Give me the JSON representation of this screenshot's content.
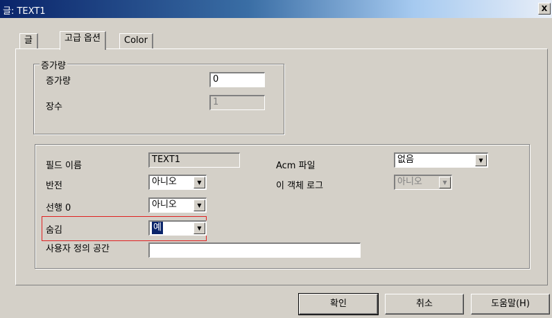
{
  "window": {
    "title": "글: TEXT1",
    "close_glyph": "X"
  },
  "tabs": [
    {
      "label": "글"
    },
    {
      "label": "고급 옵션"
    },
    {
      "label": "Color"
    }
  ],
  "increment_group": {
    "legend": "증가량",
    "increment_label": "증가량",
    "increment_value": "0",
    "count_label": "장수",
    "count_value": "1"
  },
  "field_group": {
    "field_name_label": "필드 이름",
    "field_name_value": "TEXT1",
    "acm_file_label": "Acm 파일",
    "acm_file_value": "없음",
    "reverse_label": "반전",
    "reverse_value": "아니오",
    "log_label": "이 객체 로그",
    "log_value": "아니오",
    "leading_zero_label": "선행 0",
    "leading_zero_value": "아니오",
    "hide_label": "숨김",
    "hide_value": "예",
    "user_space_label": "사용자 정의 공간",
    "user_space_value": ""
  },
  "buttons": {
    "ok": "확인",
    "cancel": "취소",
    "help": "도움말(H)"
  },
  "dropdown_glyph": "▼",
  "colors": {
    "highlight": "#e02020",
    "title_start": "#0a246a"
  }
}
